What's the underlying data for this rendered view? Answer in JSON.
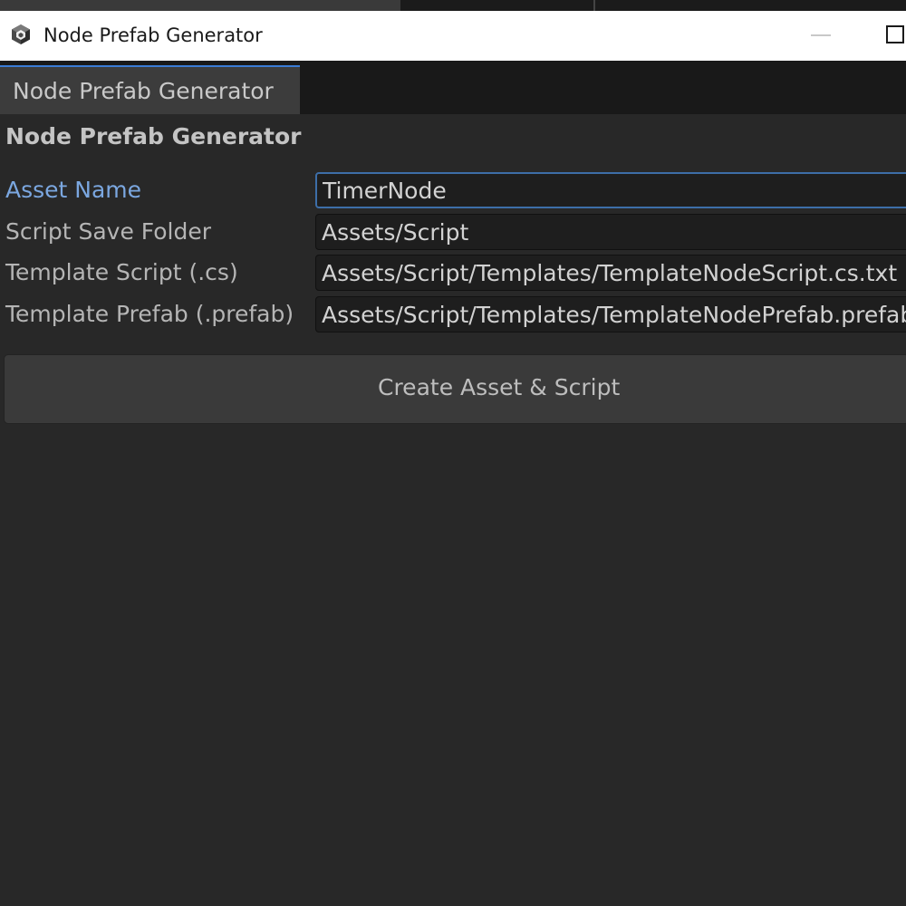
{
  "window": {
    "title": "Node Prefab Generator",
    "app_icon": "unity-cube-icon",
    "controls": [
      "minimize-icon",
      "maximize-icon"
    ]
  },
  "tab": {
    "label": "Node Prefab Generator"
  },
  "panel": {
    "heading": "Node Prefab Generator",
    "fields": [
      {
        "label": "Asset Name",
        "value": "TimerNode",
        "focused": true
      },
      {
        "label": "Script Save Folder",
        "value": "Assets/Script"
      },
      {
        "label": "Template Script (.cs)",
        "value": "Assets/Script/Templates/TemplateNodeScript.cs.txt"
      },
      {
        "label": "Template Prefab (.prefab)",
        "value": "Assets/Script/Templates/TemplateNodePrefab.prefab"
      }
    ],
    "create_button_label": "Create Asset & Script"
  },
  "colors": {
    "focused_label": "#7ba7e0",
    "focus_border": "#3d6ea8",
    "tab_accent": "#3a7bd5",
    "background": "#282828"
  }
}
